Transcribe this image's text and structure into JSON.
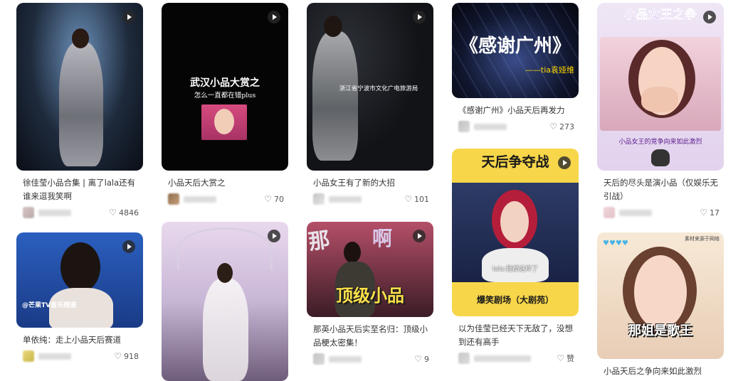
{
  "cards": [
    {
      "id": "c1",
      "title": "徐佳莹小品合集 | 离了lala还有谁来逗我笑啊",
      "likes": "4846"
    },
    {
      "id": "c2",
      "title": "小品天后大赏之",
      "likes": "70",
      "overlay": {
        "line1": "武汉小品大赏之",
        "line2": "怎么一直都在错plus"
      }
    },
    {
      "id": "c3",
      "title": "小品女王有了新的大招",
      "likes": "101",
      "overlay": {
        "caption": "浙江省宁波市文化广电旅游局"
      }
    },
    {
      "id": "c4",
      "title": "《感谢广州》小品天后再发力",
      "likes": "273",
      "overlay": {
        "big": "《感谢广州》",
        "sub": "——tia袁娅维"
      }
    },
    {
      "id": "c5",
      "title": "天后的尽头是演小品（仅娱乐无引战）",
      "likes": "17",
      "overlay": {
        "banner": "小品女王之争",
        "caption": "小品女王的竞争向来如此激烈"
      }
    },
    {
      "id": "c6",
      "title": "单依纯：走上小品天后赛道",
      "likes": "918",
      "overlay": {
        "logo": "@芒果TV音乐频道"
      }
    },
    {
      "id": "c7",
      "title": "",
      "likes": ""
    },
    {
      "id": "c8",
      "title": "那英小品天后实至名归：顶级小品梗太密集！",
      "likes": "9",
      "overlay": {
        "big": "顶级小品",
        "tag1": "那",
        "tag2": "啊"
      }
    },
    {
      "id": "c9",
      "title": "以为佳莹已经天下无敌了，没想到还有高手",
      "likes": "赞",
      "overlay": {
        "banner": "天后争夺战",
        "caption": "lala:我都这样了",
        "bottom": "爆笑剧场（大剧苑）"
      }
    },
    {
      "id": "c10",
      "title": "小品天后之争向来如此激烈",
      "likes": "",
      "overlay": {
        "big": "那姐是歌王",
        "corner": "素材来源于网络"
      }
    }
  ]
}
